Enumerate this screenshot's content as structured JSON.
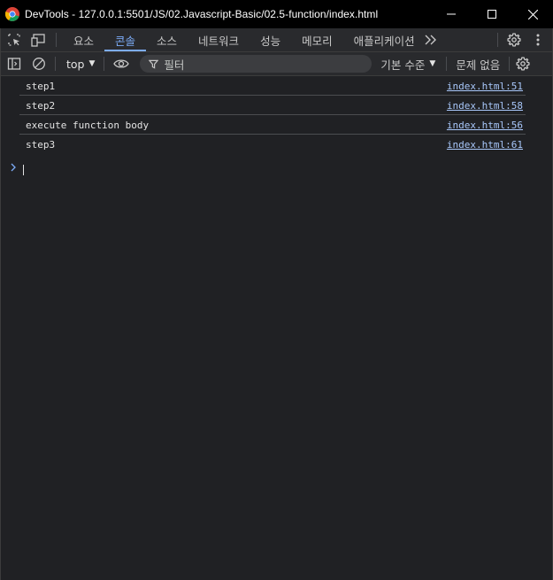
{
  "window": {
    "title": "DevTools - 127.0.0.1:5501/JS/02.Javascript-Basic/02.5-function/index.html"
  },
  "tabs": [
    {
      "label": "요소",
      "active": false
    },
    {
      "label": "콘솔",
      "active": true
    },
    {
      "label": "소스",
      "active": false
    },
    {
      "label": "네트워크",
      "active": false
    },
    {
      "label": "성능",
      "active": false
    },
    {
      "label": "메모리",
      "active": false
    },
    {
      "label": "애플리케이션",
      "active": false
    }
  ],
  "console_toolbar": {
    "context": "top",
    "filter_placeholder": "필터",
    "levels": "기본 수준",
    "issues": "문제 없음"
  },
  "messages": [
    {
      "text": "step1",
      "source": "index.html:51"
    },
    {
      "text": "step2",
      "source": "index.html:58"
    },
    {
      "text": "execute function body",
      "source": "index.html:56"
    },
    {
      "text": "step3",
      "source": "index.html:61"
    }
  ],
  "colors": {
    "accent": "#7cacf8",
    "link": "#a8c7fa",
    "background": "#202124",
    "toolbar": "#292a2d"
  },
  "icons": {
    "inspect": "inspect-element-icon",
    "device": "device-toolbar-icon",
    "more_tabs": "chevron-double-right-icon",
    "settings": "gear-icon",
    "menu": "kebab-menu-icon",
    "sidebar": "sidebar-toggle-icon",
    "clear": "clear-console-icon",
    "live_expression": "eye-icon",
    "filter": "filter-funnel-icon",
    "prompt": "chevron-right-icon"
  }
}
